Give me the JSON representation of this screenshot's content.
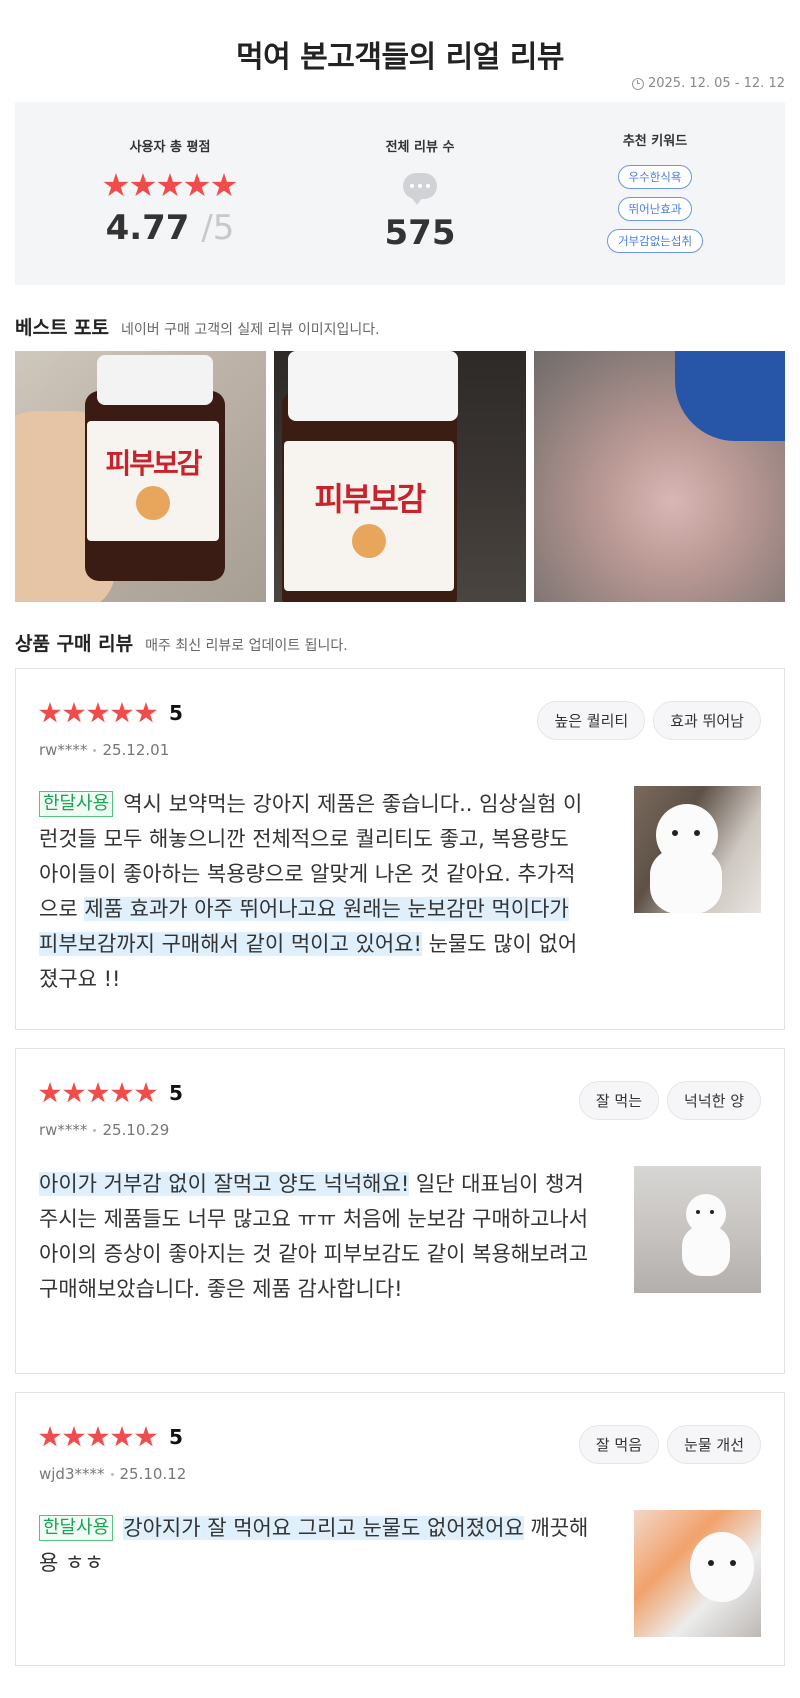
{
  "header": {
    "title": "먹여 본고객들의 리얼 리뷰",
    "date_range": "2025. 12. 05 - 12. 12",
    "date_icon": "clock-icon"
  },
  "summary": {
    "rating_label": "사용자 총 평점",
    "rating_value": "4.77",
    "rating_max": "5",
    "rating_separator": "/",
    "stars": 5,
    "count_label": "전체 리뷰 수",
    "count_icon": "chat-bubble-icon",
    "count_value": "575",
    "keywords_label": "추천 키워드",
    "keywords": [
      "우수한식욕",
      "뛰어난효과",
      "거부감없는섭취"
    ]
  },
  "best_photo": {
    "title": "베스트 포토",
    "subtitle": "네이버 구매 고객의 실제 리뷰 이미지입니다."
  },
  "reviews_section": {
    "title": "상품 구매 리뷰",
    "subtitle": "매주 최신 리뷰로 업데이트 됩니다."
  },
  "reviews": [
    {
      "score": "5",
      "stars": 5,
      "user": "rw****",
      "date": "25.12.01",
      "tags": [
        "높은 퀄리티",
        "효과 뛰어남"
      ],
      "badge": "한달사용",
      "text_plain_1": "역시 보약먹는 강아지 제품은 좋습니다.. 임상실험 이런것들 모두 해놓으니깐 전체적으로 퀄리티도 좋고, 복용량도 아이들이 좋아하는 복용량으로 알맞게 나온 것 같아요. 추가적으로 ",
      "text_highlight": "제품 효과가 아주 뛰어나고요 원래는 눈보감만 먹이다가 피부보감까지 구매해서 같이 먹이고 있어요!",
      "text_plain_2": " 눈물도 많이 없어졌구요 !!"
    },
    {
      "score": "5",
      "stars": 5,
      "user": "rw****",
      "date": "25.10.29",
      "tags": [
        "잘 먹는",
        "넉넉한 양"
      ],
      "text_highlight": "아이가 거부감 없이 잘먹고 양도 넉넉해요!",
      "text_plain_2": " 일단 대표님이 챙겨주시는 제품들도 너무 많고요 ㅠㅠ 처음에 눈보감 구매하고나서 아이의 증상이 좋아지는 것 같아 피부보감도 같이 복용해보려고 구매해보았습니다. 좋은 제품 감사합니다!"
    },
    {
      "score": "5",
      "stars": 5,
      "user": "wjd3****",
      "date": "25.10.12",
      "tags": [
        "잘 먹음",
        "눈물 개선"
      ],
      "badge": "한달사용",
      "text_highlight": "강아지가 잘 먹어요 그리고 눈물도 없어졌어요",
      "text_plain_2": " 깨끗해용 ㅎㅎ"
    }
  ],
  "product": {
    "brand_text": "피부보감",
    "colors": {
      "accent_red": "#f14b4b",
      "keyword_blue": "#4a7ee6",
      "badge_green": "#18a356",
      "highlight": "#dff0fc"
    }
  }
}
